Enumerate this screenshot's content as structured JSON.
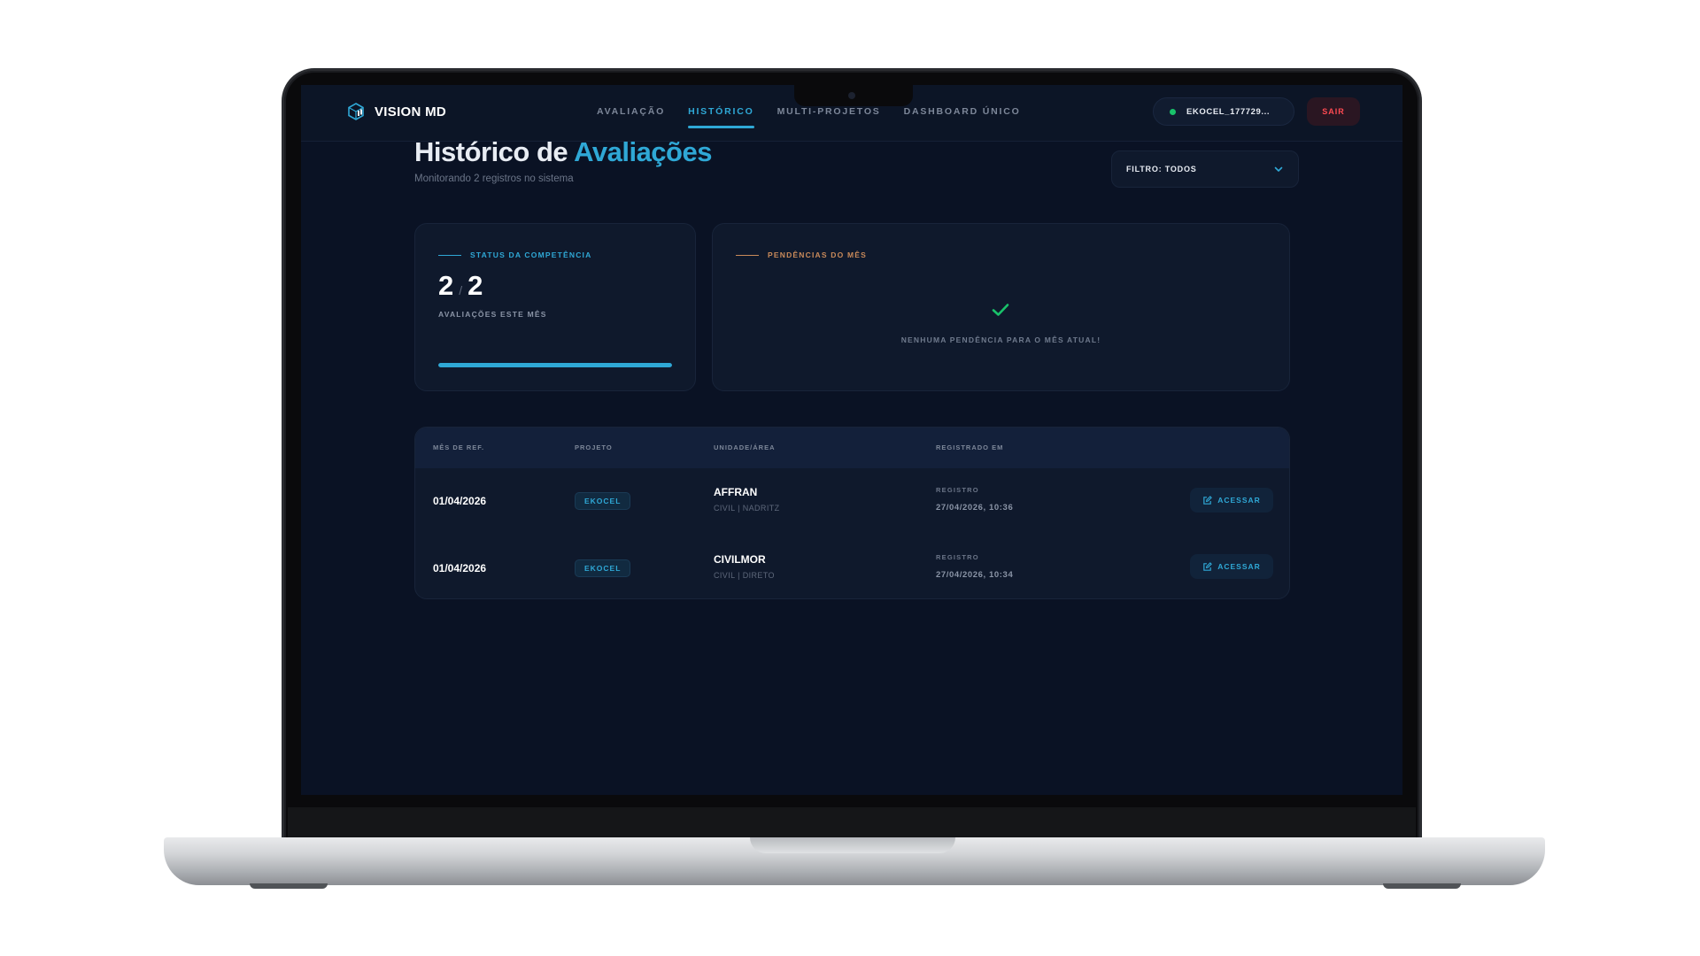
{
  "app": {
    "name": "VISION MD",
    "icon": "cube-logo-icon"
  },
  "nav": [
    {
      "label": "AVALIAÇÃO",
      "active": false
    },
    {
      "label": "HISTÓRICO",
      "active": true
    },
    {
      "label": "MULTI-PROJETOS",
      "active": false
    },
    {
      "label": "DASHBOARD ÚNICO",
      "active": false
    }
  ],
  "user": {
    "name": "EKOCEL_177729...",
    "status_color": "#19c26a"
  },
  "logout_label": "SAIR",
  "page": {
    "title_prefix": "Histórico de",
    "title_accent": "Avaliações",
    "subtitle": "Monitorando 2 registros no sistema"
  },
  "filter": {
    "label": "FILTRO: TODOS",
    "icon": "chevron-down-icon"
  },
  "status_card": {
    "label": "STATUS DA COMPETÊNCIA",
    "done": "2",
    "separator": "/",
    "total": "2",
    "caption": "AVALIAÇÕES ESTE MÊS",
    "progress": 1.0
  },
  "pending_card": {
    "label": "PENDÊNCIAS DO MÊS",
    "icon": "check-icon",
    "message": "NENHUMA PENDÊNCIA PARA O MÊS ATUAL!"
  },
  "table": {
    "headers": [
      "MÊS DE REF.",
      "PROJETO",
      "UNIDADE/ÁREA",
      "REGISTRADO EM"
    ],
    "rows": [
      {
        "month": "01/04/2026",
        "project": "EKOCEL",
        "unit": "AFFRAN",
        "unit_sub": "CIVIL | NADRITZ",
        "reg_label": "REGISTRO",
        "reg_date": "27/04/2026, 10:36",
        "action": "ACESSAR"
      },
      {
        "month": "01/04/2026",
        "project": "EKOCEL",
        "unit": "CIVILMOR",
        "unit_sub": "CIVIL | DIRETO",
        "reg_label": "REGISTRO",
        "reg_date": "27/04/2026, 10:34",
        "action": "ACESSAR"
      }
    ]
  },
  "colors": {
    "accent": "#2fa8d6",
    "pending_accent": "#c98a5a",
    "danger": "#ff4a52",
    "success": "#19c26a",
    "bg": "#0a1224"
  }
}
